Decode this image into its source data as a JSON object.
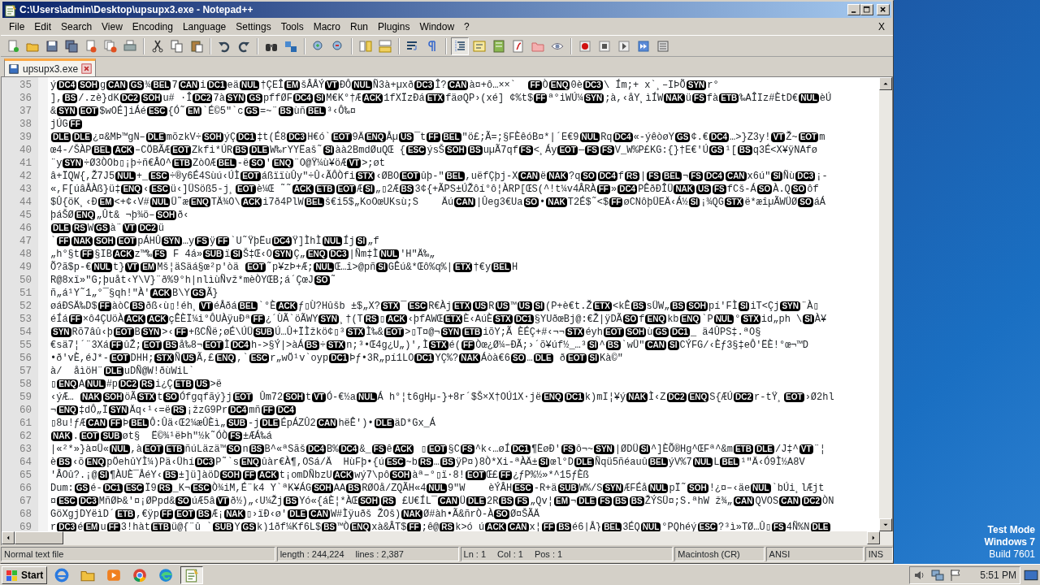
{
  "window": {
    "title": "C:\\Users\\admin\\Desktop\\upsupx3.exe - Notepad++"
  },
  "menu": [
    "File",
    "Edit",
    "Search",
    "View",
    "Encoding",
    "Language",
    "Settings",
    "Tools",
    "Macro",
    "Run",
    "Plugins",
    "Window",
    "?"
  ],
  "menu_close": "X",
  "toolbar": [
    {
      "pressed": false
    },
    {
      "pressed": false
    },
    {
      "pressed": false
    },
    {
      "pressed": false
    },
    {
      "pressed": false
    },
    {
      "pressed": false
    },
    {
      "pressed": false
    },
    {
      "pressed": false
    },
    {
      "pressed": false
    },
    {
      "pressed": false
    },
    {
      "pressed": false
    },
    {
      "pressed": false
    },
    {
      "pressed": false
    },
    {
      "pressed": false
    },
    {
      "pressed": false
    },
    {
      "pressed": false
    },
    {
      "pressed": false
    },
    {
      "pressed": false
    },
    {
      "pressed": false
    },
    {
      "pressed": false
    },
    {
      "pressed": true
    },
    {
      "pressed": false
    },
    {
      "pressed": false
    },
    {
      "pressed": false
    },
    {
      "pressed": false
    },
    {
      "pressed": false
    },
    {
      "pressed": false
    },
    {
      "pressed": false
    },
    {
      "pressed": false
    },
    {
      "pressed": false
    },
    {
      "pressed": false
    }
  ],
  "tabs": [
    {
      "label": "upsupx3.exe",
      "selected": true
    }
  ],
  "lines": [
    {
      "number": "35",
      "segments": [
        {
          "text": "ý"
        },
        {
          "ctrl": "DC4"
        },
        {
          "ctrl": "SOH"
        },
        {
          "text": "g"
        },
        {
          "ctrl": "CAN"
        },
        {
          "ctrl": "GS"
        },
        {
          "text": "¾"
        },
        {
          "ctrl": "BEL"
        },
        {
          "text": "7"
        },
        {
          "ctrl": "CAN"
        },
        {
          "text": "i"
        },
        {
          "ctrl": "DC1"
        },
        {
          "text": "eä"
        },
        {
          "ctrl": "NUL"
        },
        {
          "text": "†ÇEÎ"
        },
        {
          "ctrl": "EM"
        },
        {
          "text": "šÂÅÝ"
        },
        {
          "ctrl": "VT"
        },
        {
          "text": "ĐÔ"
        },
        {
          "ctrl": "NUL"
        },
        {
          "text": "Ñ3à+µxð"
        },
        {
          "ctrl": "DC3"
        },
        {
          "text": "Î?"
        },
        {
          "ctrl": "CAN"
        },
        {
          "text": "à¤+ô…××`  "
        },
        {
          "ctrl": "FF"
        },
        {
          "text": "Ò"
        },
        {
          "ctrl": "ENQ"
        },
        {
          "text": "0è"
        },
        {
          "ctrl": "DC3"
        },
        {
          "text": "\\ Ím;+ x`¸–IÞÕ"
        },
        {
          "ctrl": "SYN"
        },
        {
          "text": "r°"
        }
      ]
    },
    {
      "number": "36",
      "segments": [
        {
          "text": "],"
        },
        {
          "ctrl": "BS"
        },
        {
          "text": "/.zè}dK"
        },
        {
          "ctrl": "DC2"
        },
        {
          "ctrl": "SOH"
        },
        {
          "text": "u# ·Î"
        },
        {
          "ctrl": "DC2"
        },
        {
          "text": "7à"
        },
        {
          "ctrl": "SYN"
        },
        {
          "ctrl": "GS"
        },
        {
          "text": "pffØF"
        },
        {
          "ctrl": "DC4"
        },
        {
          "ctrl": "SI"
        },
        {
          "text": "M€K°†Æ"
        },
        {
          "ctrl": "ACK"
        },
        {
          "text": "1fXÏzĐá"
        },
        {
          "ctrl": "ETX"
        },
        {
          "text": "fäøQP›(xé] ¢%t$"
        },
        {
          "ctrl": "FF"
        },
        {
          "text": "ª°iWÚ¼"
        },
        {
          "ctrl": "SYN"
        },
        {
          "text": ";à,‹åY¸ìÍW"
        },
        {
          "ctrl": "NAK"
        },
        {
          "text": "ü"
        },
        {
          "ctrl": "FS"
        },
        {
          "text": "fà"
        },
        {
          "ctrl": "ETB"
        },
        {
          "text": "‰AÎIz#ÈtD€"
        },
        {
          "ctrl": "NUL"
        },
        {
          "text": "èÚ"
        }
      ]
    },
    {
      "number": "37",
      "segments": [
        {
          "text": "&"
        },
        {
          "ctrl": "SYN"
        },
        {
          "ctrl": "EOT"
        },
        {
          "text": "$wOÉ]iÁé"
        },
        {
          "ctrl": "ESC"
        },
        {
          "text": "{Ó˜"
        },
        {
          "ctrl": "EM"
        },
        {
          "text": "`É©5″`c"
        },
        {
          "ctrl": "GS"
        },
        {
          "text": "=~¨"
        },
        {
          "ctrl": "BS"
        },
        {
          "text": "ùñ"
        },
        {
          "ctrl": "BEL"
        },
        {
          "text": "³‹Ô‰¤"
        }
      ]
    },
    {
      "number": "38",
      "segments": [
        {
          "text": "jÚG"
        },
        {
          "ctrl": "FF"
        }
      ]
    },
    {
      "number": "39",
      "segments": [
        {
          "ctrl": "DLE"
        },
        {
          "ctrl": "DLE"
        },
        {
          "text": "¿¤&MÞ™gN–"
        },
        {
          "ctrl": "DLE"
        },
        {
          "text": "mõzkV÷"
        },
        {
          "ctrl": "SOH"
        },
        {
          "text": "ýÇ"
        },
        {
          "ctrl": "DC1"
        },
        {
          "text": "‡t(É8"
        },
        {
          "ctrl": "DC3"
        },
        {
          "text": "H€ó`"
        },
        {
          "ctrl": "EOT"
        },
        {
          "text": "9Ä"
        },
        {
          "ctrl": "ENQ"
        },
        {
          "text": "Åµ"
        },
        {
          "ctrl": "US"
        },
        {
          "text": "¯t"
        },
        {
          "ctrl": "FF"
        },
        {
          "ctrl": "BEL"
        },
        {
          "text": "\"ö£;Ã=;§FÈêóB¤*|´E€9"
        },
        {
          "ctrl": "NUL"
        },
        {
          "text": "Rq"
        },
        {
          "ctrl": "DC4"
        },
        {
          "text": "«-ýêòøY"
        },
        {
          "ctrl": "GS"
        },
        {
          "text": "¢.€"
        },
        {
          "ctrl": "DC4"
        },
        {
          "text": "…>}Z3y!"
        },
        {
          "ctrl": "VT"
        },
        {
          "text": "Ž~"
        },
        {
          "ctrl": "EOT"
        },
        {
          "text": "m"
        }
      ]
    },
    {
      "number": "40",
      "segments": [
        {
          "text": "œ4-/ŠÀP"
        },
        {
          "ctrl": "BEL"
        },
        {
          "ctrl": "ACK"
        },
        {
          "text": "–CÖBÃÆ"
        },
        {
          "ctrl": "EOT"
        },
        {
          "text": "Zkfi*ÚR"
        },
        {
          "ctrl": "BS"
        },
        {
          "ctrl": "DLE"
        },
        {
          "text": "W‰rYYËaš˜"
        },
        {
          "ctrl": "SI"
        },
        {
          "text": "àà2BmdØuQŒ {"
        },
        {
          "ctrl": "ESC"
        },
        {
          "text": "ýsŠ"
        },
        {
          "ctrl": "SOH"
        },
        {
          "ctrl": "BS"
        },
        {
          "text": "uµÃ7qf"
        },
        {
          "ctrl": "FS"
        },
        {
          "text": "<¸Áy"
        },
        {
          "ctrl": "EOT"
        },
        {
          "text": "—"
        },
        {
          "ctrl": "FS"
        },
        {
          "ctrl": "FS"
        },
        {
          "text": "V_W%P£KG:{}†E€'Ú"
        },
        {
          "ctrl": "GS"
        },
        {
          "text": "¹["
        },
        {
          "ctrl": "BS"
        },
        {
          "text": "q3É<X¥ÿNAfø"
        }
      ]
    },
    {
      "number": "41",
      "segments": [
        {
          "text": "¨y"
        },
        {
          "ctrl": "SYN"
        },
        {
          "text": "÷Ø3ÒOb▯¡þ÷ñ€ÂO^"
        },
        {
          "ctrl": "ETB"
        },
        {
          "text": "ZòOÆ"
        },
        {
          "ctrl": "BEL"
        },
        {
          "text": "-ë"
        },
        {
          "ctrl": "SO"
        },
        {
          "text": "'"
        },
        {
          "ctrl": "ENQ"
        },
        {
          "text": "¨O@Ÿ¼ù¥öÆ"
        },
        {
          "ctrl": "VT"
        },
        {
          "text": ">;øt"
        }
      ]
    },
    {
      "number": "42",
      "segments": [
        {
          "text": "â+ÏQW{,Ž7J5"
        },
        {
          "ctrl": "NUL"
        },
        {
          "text": "+_"
        },
        {
          "ctrl": "ESC"
        },
        {
          "text": "÷®y6É4Sùú‹ÚÌ"
        },
        {
          "ctrl": "EOT"
        },
        {
          "text": "áßïïùÛy\"÷Û‹ÃÔÒfi"
        },
        {
          "ctrl": "STX"
        },
        {
          "text": "‹ØBO"
        },
        {
          "ctrl": "EOT"
        },
        {
          "text": "ûþ-\""
        },
        {
          "ctrl": "BEL"
        },
        {
          "text": ",uëfÇþj-X"
        },
        {
          "ctrl": "CAN"
        },
        {
          "text": "ë"
        },
        {
          "ctrl": "NAK"
        },
        {
          "text": "?q"
        },
        {
          "ctrl": "SO"
        },
        {
          "ctrl": "DC4"
        },
        {
          "text": "f"
        },
        {
          "ctrl": "RS"
        },
        {
          "text": "|"
        },
        {
          "ctrl": "FS"
        },
        {
          "ctrl": "BEL"
        },
        {
          "text": "¬"
        },
        {
          "ctrl": "FS"
        },
        {
          "ctrl": "DC4"
        },
        {
          "ctrl": "CAN"
        },
        {
          "text": "x6ú\""
        },
        {
          "ctrl": "SI"
        },
        {
          "text": "Ñù"
        },
        {
          "ctrl": "DC3"
        },
        {
          "text": "¡-"
        }
      ]
    },
    {
      "number": "43",
      "segments": [
        {
          "text": "«,F[úâÅÀß}ü‡"
        },
        {
          "ctrl": "ENQ"
        },
        {
          "text": "‹"
        },
        {
          "ctrl": "ESC"
        },
        {
          "text": "ü‹]ÜSöß5-j¸"
        },
        {
          "ctrl": "EOT"
        },
        {
          "text": "è¼Œ ˜˜"
        },
        {
          "ctrl": "ACK"
        },
        {
          "ctrl": "ETB"
        },
        {
          "ctrl": "EOT"
        },
        {
          "text": "Æ"
        },
        {
          "ctrl": "SI"
        },
        {
          "text": "„▯2Æ"
        },
        {
          "ctrl": "BS"
        },
        {
          "text": "3¢{+ÃPS±ÚŽôí°ô¦ÀRP[ŒS(^!t¼v4ÂRÀ"
        },
        {
          "ctrl": "FF"
        },
        {
          "text": "»"
        },
        {
          "ctrl": "DC4"
        },
        {
          "text": "PÊðĐÎÜ"
        },
        {
          "ctrl": "NAK"
        },
        {
          "ctrl": "US"
        },
        {
          "ctrl": "FS"
        },
        {
          "text": "fCš-Á"
        },
        {
          "ctrl": "SO"
        },
        {
          "text": "À.Q"
        },
        {
          "ctrl": "SO"
        },
        {
          "text": "ôf"
        }
      ]
    },
    {
      "number": "44",
      "segments": [
        {
          "text": "$Û{öK¸‹Đ"
        },
        {
          "ctrl": "EM"
        },
        {
          "text": "<+¢‹V#"
        },
        {
          "ctrl": "NUL"
        },
        {
          "text": "Ü˜æ"
        },
        {
          "ctrl": "ENQ"
        },
        {
          "text": "TÄ¾O\\"
        },
        {
          "ctrl": "ACK"
        },
        {
          "text": "i7ð4PlW"
        },
        {
          "ctrl": "BEL"
        },
        {
          "text": "š€i5$„KoOœUKsù;S    Äú"
        },
        {
          "ctrl": "CAN"
        },
        {
          "text": "|Ûeg3€Ua"
        },
        {
          "ctrl": "SO"
        },
        {
          "text": "•"
        },
        {
          "ctrl": "NAK"
        },
        {
          "text": "T2É$˜<$"
        },
        {
          "ctrl": "FF"
        },
        {
          "text": "øCNôþÜEÄ‹Á½"
        },
        {
          "ctrl": "SI"
        },
        {
          "text": "¡¾QG"
        },
        {
          "ctrl": "STX"
        },
        {
          "text": "ë*æîµÃWÜØ"
        },
        {
          "ctrl": "SO"
        },
        {
          "text": "áÁ"
        }
      ]
    },
    {
      "number": "45",
      "segments": [
        {
          "text": "þáŠØ"
        },
        {
          "ctrl": "ENQ"
        },
        {
          "text": "„Ût& ¬þ¾ö–"
        },
        {
          "ctrl": "SOH"
        },
        {
          "text": "ð‹"
        }
      ]
    },
    {
      "number": "46",
      "segments": [
        {
          "ctrl": "DLE"
        },
        {
          "ctrl": "RS"
        },
        {
          "text": "W"
        },
        {
          "ctrl": "GS"
        },
        {
          "text": "à¨"
        },
        {
          "ctrl": "VT"
        },
        {
          "ctrl": "DC2"
        },
        {
          "text": "ü"
        }
      ]
    },
    {
      "number": "47",
      "segments": [
        {
          "text": "`"
        },
        {
          "ctrl": "FF"
        },
        {
          "ctrl": "NAK"
        },
        {
          "ctrl": "SOH"
        },
        {
          "ctrl": "EOT"
        },
        {
          "text": "pÁHÛ"
        },
        {
          "ctrl": "SYN"
        },
        {
          "text": "…y"
        },
        {
          "ctrl": "FS"
        },
        {
          "text": "ÿ"
        },
        {
          "ctrl": "FF"
        },
        {
          "text": "`U˜ŸþËu"
        },
        {
          "ctrl": "DC4"
        },
        {
          "text": "Ÿ]ÌhÌ"
        },
        {
          "ctrl": "NUL"
        },
        {
          "text": "Íj"
        },
        {
          "ctrl": "SI"
        },
        {
          "text": "„f"
        }
      ]
    },
    {
      "number": "48",
      "segments": [
        {
          "text": "„h°§t"
        },
        {
          "ctrl": "FF"
        },
        {
          "text": "§IB"
        },
        {
          "ctrl": "ACK"
        },
        {
          "text": "z™‰"
        },
        {
          "ctrl": "FS"
        },
        {
          "text": " F 4á»"
        },
        {
          "ctrl": "SUB"
        },
        {
          "text": "ï"
        },
        {
          "ctrl": "SI"
        },
        {
          "text": "Š‡Œ‹O"
        },
        {
          "ctrl": "SYN"
        },
        {
          "text": "Ç„"
        },
        {
          "ctrl": "ENQ"
        },
        {
          "ctrl": "DC3"
        },
        {
          "text": "|Ñm‡Ì"
        },
        {
          "ctrl": "NUL"
        },
        {
          "text": "'H\"Ä‰„"
        }
      ]
    },
    {
      "number": "49",
      "segments": [
        {
          "text": "Õ?ã$p-€"
        },
        {
          "ctrl": "NUL"
        },
        {
          "text": "t}"
        },
        {
          "ctrl": "VT"
        },
        {
          "ctrl": "EM"
        },
        {
          "text": "Mš¦äSäá§œ²p'òä "
        },
        {
          "ctrl": "EOT"
        },
        {
          "text": "˜p¥zÞ+Æ;"
        },
        {
          "ctrl": "NUL"
        },
        {
          "text": "Œ…î>@pñ"
        },
        {
          "ctrl": "SI"
        },
        {
          "text": "GÊú&*Œô%q%|"
        },
        {
          "ctrl": "ETX"
        },
        {
          "text": "†€y"
        },
        {
          "ctrl": "BEL"
        },
        {
          "text": "H"
        }
      ]
    },
    {
      "number": "50",
      "segments": [
        {
          "text": "R@8xï»″G;þuåt‹Y\\V}¨ð%9°h|nlìùÑvž*mèÒYŒB;á´ÇœJ"
        },
        {
          "ctrl": "SO"
        },
        {
          "text": "˜"
        }
      ]
    },
    {
      "number": "51",
      "segments": [
        {
          "text": "ñ„á¹Y˜1„°¯§qh!″À'"
        },
        {
          "ctrl": "ACK"
        },
        {
          "text": "B\\Y"
        },
        {
          "ctrl": "GS"
        },
        {
          "text": "Ã}"
        }
      ]
    },
    {
      "number": "52",
      "segments": [
        {
          "text": "øáĐSÄ‰D$"
        },
        {
          "ctrl": "FF"
        },
        {
          "text": "àòC"
        },
        {
          "ctrl": "BS"
        },
        {
          "text": "ðß‹ù▯!éh¸"
        },
        {
          "ctrl": "VT"
        },
        {
          "text": "éÅðá"
        },
        {
          "ctrl": "BEL"
        },
        {
          "text": "`°È"
        },
        {
          "ctrl": "ACK"
        },
        {
          "text": "ƒ▯Ù?Hûšb ±$„X?"
        },
        {
          "ctrl": "STX"
        },
        {
          "text": "¯"
        },
        {
          "ctrl": "ESC"
        },
        {
          "text": "R€Àj"
        },
        {
          "ctrl": "ETX"
        },
        {
          "ctrl": "US"
        },
        {
          "text": "R"
        },
        {
          "ctrl": "US"
        },
        {
          "text": "™"
        },
        {
          "ctrl": "US"
        },
        {
          "ctrl": "SI"
        },
        {
          "text": "(P+è€t.Ž"
        },
        {
          "ctrl": "ETX"
        },
        {
          "text": "<kÊ"
        },
        {
          "ctrl": "BS"
        },
        {
          "text": "sÜW„"
        },
        {
          "ctrl": "BS"
        },
        {
          "ctrl": "SOH"
        },
        {
          "text": "pí'FÌ"
        },
        {
          "ctrl": "SI"
        },
        {
          "text": "iT<Çj"
        },
        {
          "ctrl": "SYN"
        },
        {
          "text": "¨À▯"
        }
      ]
    },
    {
      "number": "53",
      "segments": [
        {
          "text": "éÍá"
        },
        {
          "ctrl": "FF"
        },
        {
          "text": "×ô4ÇUöÀ"
        },
        {
          "ctrl": "ACK"
        },
        {
          "ctrl": "ACK"
        },
        {
          "text": "çÊÈÏ¼i°ÔUÀÿuÐª"
        },
        {
          "ctrl": "FF"
        },
        {
          "text": "¿´ÙÃ`öÃWY"
        },
        {
          "ctrl": "SYN"
        },
        {
          "text": "¸†(T"
        },
        {
          "ctrl": "RS"
        },
        {
          "text": "▯"
        },
        {
          "ctrl": "ACK"
        },
        {
          "text": "‹þfAWŒ"
        },
        {
          "ctrl": "ETX"
        },
        {
          "text": "È‹AúÈ"
        },
        {
          "ctrl": "STX"
        },
        {
          "ctrl": "DC1"
        },
        {
          "text": "§YUðœBj@:€Ž|ÿDÃ"
        },
        {
          "ctrl": "SO"
        },
        {
          "text": "f"
        },
        {
          "ctrl": "ENQ"
        },
        {
          "text": "kb"
        },
        {
          "ctrl": "ENQ"
        },
        {
          "text": "`P"
        },
        {
          "ctrl": "NUL"
        },
        {
          "text": "°"
        },
        {
          "ctrl": "STX"
        },
        {
          "text": "id„ph \\"
        },
        {
          "ctrl": "SI"
        },
        {
          "text": "À¥"
        }
      ]
    },
    {
      "number": "54",
      "segments": [
        {
          "ctrl": "SYN"
        },
        {
          "text": "Rõ7âû‹þ"
        },
        {
          "ctrl": "EOT"
        },
        {
          "text": "B"
        },
        {
          "ctrl": "SYN"
        },
        {
          "text": ">‹"
        },
        {
          "ctrl": "FF"
        },
        {
          "text": "+ßCÑë;øÉ\\ÚÜ"
        },
        {
          "ctrl": "SUB"
        },
        {
          "text": "Ú…Û+ÏÌžkö¢▯³"
        },
        {
          "ctrl": "STX"
        },
        {
          "text": "Ì‰&"
        },
        {
          "ctrl": "EOT"
        },
        {
          "text": ">▯T¤@¬"
        },
        {
          "ctrl": "SYN"
        },
        {
          "ctrl": "ETB"
        },
        {
          "text": "iõY;Ã ÈÉÇ+#‹¬¬"
        },
        {
          "ctrl": "STX"
        },
        {
          "text": "éyh"
        },
        {
          "ctrl": "EOT"
        },
        {
          "ctrl": "SOH"
        },
        {
          "text": "ù"
        },
        {
          "ctrl": "GS"
        },
        {
          "ctrl": "DC1"
        },
        {
          "text": "_ ä4ÛPS‡.ªO§"
        }
      ]
    },
    {
      "number": "55",
      "segments": [
        {
          "text": "€sä7¦´¨3Xá"
        },
        {
          "ctrl": "FF"
        },
        {
          "text": "ûŽ;"
        },
        {
          "ctrl": "EOT"
        },
        {
          "ctrl": "BS"
        },
        {
          "text": "å‰8¬"
        },
        {
          "ctrl": "EOT"
        },
        {
          "text": "Ì"
        },
        {
          "ctrl": "DC4"
        },
        {
          "text": "h->§Ý|>àÁ"
        },
        {
          "ctrl": "BS"
        },
        {
          "text": "÷"
        },
        {
          "ctrl": "STX"
        },
        {
          "text": "n;³•Œ4g¿U„)',Ì"
        },
        {
          "ctrl": "STX"
        },
        {
          "text": "é("
        },
        {
          "ctrl": "FF"
        },
        {
          "text": "Òœ¿Ø¼–ĐÃ;›´õ¥úf½_…³"
        },
        {
          "ctrl": "SI"
        },
        {
          "text": "^"
        },
        {
          "ctrl": "BS"
        },
        {
          "text": "`wÜ″"
        },
        {
          "ctrl": "CAN"
        },
        {
          "ctrl": "SI"
        },
        {
          "text": "CÝFG/‹Èƒ3§‡eÔ'ËÈ!°œ¬™D"
        }
      ]
    },
    {
      "number": "56",
      "segments": [
        {
          "text": "•ð'vÈ,éJ*-"
        },
        {
          "ctrl": "EOT"
        },
        {
          "text": "DHH;"
        },
        {
          "ctrl": "STX"
        },
        {
          "text": "Ñ"
        },
        {
          "ctrl": "US"
        },
        {
          "text": "Ã,£"
        },
        {
          "ctrl": "ENQ"
        },
        {
          "text": ",`"
        },
        {
          "ctrl": "ESC"
        },
        {
          "text": "r„wÖ¹v`oyp"
        },
        {
          "ctrl": "DC1"
        },
        {
          "text": "Þƒ•3R„pí1LO"
        },
        {
          "ctrl": "DC1"
        },
        {
          "text": "YÇ%?"
        },
        {
          "ctrl": "NAK"
        },
        {
          "text": "Áòà€6"
        },
        {
          "ctrl": "SO"
        },
        {
          "text": "…"
        },
        {
          "ctrl": "DLE"
        },
        {
          "text": " ð"
        },
        {
          "ctrl": "EOT"
        },
        {
          "ctrl": "SI"
        },
        {
          "text": "Kà©″"
        }
      ]
    },
    {
      "number": "57",
      "segments": [
        {
          "text": "à/  åìöH¨"
        },
        {
          "ctrl": "DLE"
        },
        {
          "text": "uDÑ@W!ðùWiL`"
        }
      ]
    },
    {
      "number": "58",
      "segments": [
        {
          "text": "▯"
        },
        {
          "ctrl": "ENQ"
        },
        {
          "text": "A"
        },
        {
          "ctrl": "NUL"
        },
        {
          "text": "#p"
        },
        {
          "ctrl": "DC2"
        },
        {
          "ctrl": "RS"
        },
        {
          "text": "i¿Ç"
        },
        {
          "ctrl": "ETB"
        },
        {
          "ctrl": "US"
        },
        {
          "text": ">ë"
        }
      ]
    },
    {
      "number": "59",
      "segments": [
        {
          "text": "‹ýÆ… "
        },
        {
          "ctrl": "NAK"
        },
        {
          "ctrl": "SOH"
        },
        {
          "text": "öÃ"
        },
        {
          "ctrl": "STX"
        },
        {
          "text": "t"
        },
        {
          "ctrl": "SO"
        },
        {
          "text": "Ófgqfãý}j"
        },
        {
          "ctrl": "EOT"
        },
        {
          "text": " Ûm72"
        },
        {
          "ctrl": "SOH"
        },
        {
          "text": "t"
        },
        {
          "ctrl": "VT"
        },
        {
          "text": "Ó-€½a"
        },
        {
          "ctrl": "NUL"
        },
        {
          "text": "Á h°¦t6gHµ-}+8r´$Š×X†OÚ1X·jë"
        },
        {
          "ctrl": "ENQ"
        },
        {
          "ctrl": "DC1"
        },
        {
          "text": "k)mI¦¥ý"
        },
        {
          "ctrl": "NAK"
        },
        {
          "text": "Ì‹Z"
        },
        {
          "ctrl": "DC2"
        },
        {
          "ctrl": "ENQ"
        },
        {
          "text": "S{ÆÚ"
        },
        {
          "ctrl": "DC2"
        },
        {
          "text": "r-tŸ¸"
        },
        {
          "ctrl": "EOT"
        },
        {
          "text": "›Ø2hl"
        }
      ]
    },
    {
      "number": "60",
      "segments": [
        {
          "text": "¬"
        },
        {
          "ctrl": "ENQ"
        },
        {
          "text": "‡dÔ„Ï"
        },
        {
          "ctrl": "SYN"
        },
        {
          "text": "Äq‹¹‹=ë"
        },
        {
          "ctrl": "RS"
        },
        {
          "text": "¡žzG9Pr"
        },
        {
          "ctrl": "DC4"
        },
        {
          "text": "mñ"
        },
        {
          "ctrl": "FF"
        },
        {
          "ctrl": "DC4"
        }
      ]
    },
    {
      "number": "61",
      "segments": [
        {
          "text": "▯8u!ƒÆ"
        },
        {
          "ctrl": "CAN"
        },
        {
          "ctrl": "FF"
        },
        {
          "text": "Þ"
        },
        {
          "ctrl": "BEL"
        },
        {
          "text": "Ô:Ûä‹Œ2¼æÛÈì„"
        },
        {
          "ctrl": "SUB"
        },
        {
          "text": "-j"
        },
        {
          "ctrl": "DLE"
        },
        {
          "text": "ÉpÁZÛ2"
        },
        {
          "ctrl": "CAN"
        },
        {
          "text": "hëÊ')•"
        },
        {
          "ctrl": "DLE"
        },
        {
          "text": "äD*Gx_Á"
        }
      ]
    },
    {
      "number": "62",
      "segments": [
        {
          "ctrl": "NAK"
        },
        {
          "text": "."
        },
        {
          "ctrl": "EOT"
        },
        {
          "ctrl": "SUB"
        },
        {
          "text": "øt§  Ë©¾¹ëÞh″½k˜ÓÒ"
        },
        {
          "ctrl": "FS"
        },
        {
          "text": "±ÆÁ‰á"
        }
      ]
    },
    {
      "number": "63",
      "segments": [
        {
          "text": "|«²*»}à¤Ü«"
        },
        {
          "ctrl": "NUL"
        },
        {
          "text": ",à"
        },
        {
          "ctrl": "EOT"
        },
        {
          "ctrl": "ETB"
        },
        {
          "text": "ñúLäzä™"
        },
        {
          "ctrl": "SO"
        },
        {
          "text": "n"
        },
        {
          "ctrl": "BS"
        },
        {
          "text": "B^«ªSãš"
        },
        {
          "ctrl": "DC4"
        },
        {
          "text": "B%"
        },
        {
          "ctrl": "DC4"
        },
        {
          "text": "&_"
        },
        {
          "ctrl": "FS"
        },
        {
          "text": "ê"
        },
        {
          "ctrl": "ACK"
        },
        {
          "text": " ▯"
        },
        {
          "ctrl": "EOT"
        },
        {
          "text": "§C"
        },
        {
          "ctrl": "FS"
        },
        {
          "text": "^k‹…øÍ"
        },
        {
          "ctrl": "DC1"
        },
        {
          "text": "¶ËøÐ'"
        },
        {
          "ctrl": "FS"
        },
        {
          "text": "ô¬~"
        },
        {
          "ctrl": "SYN"
        },
        {
          "text": "|ØDÜ"
        },
        {
          "ctrl": "SI"
        },
        {
          "text": "^]ÈÕ®Hg^ŒFª^&m"
        },
        {
          "ctrl": "ETB"
        },
        {
          "ctrl": "DLE"
        },
        {
          "text": "/J‡^"
        },
        {
          "ctrl": "VT"
        },
        {
          "text": "¨¦"
        }
      ]
    },
    {
      "number": "64",
      "segments": [
        {
          "text": "è"
        },
        {
          "ctrl": "BS"
        },
        {
          "text": "‹õ"
        },
        {
          "ctrl": "ENQ"
        },
        {
          "text": "pÖehûYÌ¼)Pä‹Ühí"
        },
        {
          "ctrl": "DC3"
        },
        {
          "text": "P˜`s"
        },
        {
          "ctrl": "ENQ"
        },
        {
          "text": "ûàr€À¶,OSá/Ä  HùFþ•{ú"
        },
        {
          "ctrl": "ESC"
        },
        {
          "text": "~b"
        },
        {
          "ctrl": "RS"
        },
        {
          "text": "…"
        },
        {
          "ctrl": "BS"
        },
        {
          "text": "ÿP¤)8Ò*Xi-ªÀÄ±"
        },
        {
          "ctrl": "SI"
        },
        {
          "text": "œl°D"
        },
        {
          "ctrl": "DLE"
        },
        {
          "text": "Ñqü5ñéauû"
        },
        {
          "ctrl": "BEL"
        },
        {
          "text": "ýV%7"
        },
        {
          "ctrl": "NUL"
        },
        {
          "text": "L"
        },
        {
          "ctrl": "BEL"
        },
        {
          "text": "¹″Ä‹Ó9Ì½A8V"
        }
      ]
    },
    {
      "number": "65",
      "segments": [
        {
          "text": "'ÂOû?.¡@"
        },
        {
          "ctrl": "SI"
        },
        {
          "text": "¶ÀUÈ¯ÅéY‹"
        },
        {
          "ctrl": "BS"
        },
        {
          "text": "±]ü]àöD"
        },
        {
          "ctrl": "SOH"
        },
        {
          "ctrl": "FF"
        },
        {
          "ctrl": "ACK"
        },
        {
          "text": "t¡omDÑbzU"
        },
        {
          "ctrl": "ACK"
        },
        {
          "text": "wý7\\pô"
        },
        {
          "ctrl": "SOH"
        },
        {
          "text": "àª–°▯ï·8!"
        },
        {
          "ctrl": "EOT"
        },
        {
          "text": "Œ£"
        },
        {
          "ctrl": "FF"
        },
        {
          "text": "¿ƒP%½»*^15ƒÈß"
        }
      ]
    },
    {
      "number": "66",
      "segments": [
        {
          "text": "Dum:"
        },
        {
          "ctrl": "GS"
        },
        {
          "text": "é-"
        },
        {
          "ctrl": "DC1"
        },
        {
          "ctrl": "ESC"
        },
        {
          "text": "Ï9"
        },
        {
          "ctrl": "RS"
        },
        {
          "text": "_K¬"
        },
        {
          "ctrl": "ESC"
        },
        {
          "text": "Ò¾iM,É¨k4 Y`ªK¥ÁG"
        },
        {
          "ctrl": "SOH"
        },
        {
          "text": "AA"
        },
        {
          "ctrl": "BS"
        },
        {
          "text": "RØOå/ZQÃH«4"
        },
        {
          "ctrl": "NUL"
        },
        {
          "text": "9\"W    èÝÂH"
        },
        {
          "ctrl": "ESC"
        },
        {
          "text": "-R+ä"
        },
        {
          "ctrl": "SUB"
        },
        {
          "text": "W%/S"
        },
        {
          "ctrl": "SYN"
        },
        {
          "text": "ÆFÉå"
        },
        {
          "ctrl": "NUL"
        },
        {
          "text": "pÏ˜"
        },
        {
          "ctrl": "SOH"
        },
        {
          "text": "!¿¤–‹äe"
        },
        {
          "ctrl": "NUL"
        },
        {
          "text": "`bÚi¸lÆjt"
        }
      ]
    },
    {
      "number": "67",
      "segments": [
        {
          "text": "¤"
        },
        {
          "ctrl": "ESC"
        },
        {
          "ctrl": "DC3"
        },
        {
          "text": "MñØÞ&'¤¡ØPpd&"
        },
        {
          "ctrl": "SO"
        },
        {
          "text": "úÆ5â"
        },
        {
          "ctrl": "VT"
        },
        {
          "text": "ð½)„‹U¼Žj"
        },
        {
          "ctrl": "BS"
        },
        {
          "text": "Yó«{áÈ¦*ÀŒ"
        },
        {
          "ctrl": "SOH"
        },
        {
          "ctrl": "RS"
        },
        {
          "text": " £U€ÍL¯"
        },
        {
          "ctrl": "CAN"
        },
        {
          "text": "Ü"
        },
        {
          "ctrl": "DLE"
        },
        {
          "text": "2R"
        },
        {
          "ctrl": "BS"
        },
        {
          "ctrl": "FS"
        },
        {
          "text": "„Qv¦"
        },
        {
          "ctrl": "EM"
        },
        {
          "text": "¬"
        },
        {
          "ctrl": "DLE"
        },
        {
          "ctrl": "FS"
        },
        {
          "ctrl": "BS"
        },
        {
          "ctrl": "BS"
        },
        {
          "text": "ŽÝSÜ¤;S.ªhW ž¾„"
        },
        {
          "ctrl": "CAN"
        },
        {
          "text": "QVOS"
        },
        {
          "ctrl": "CAN"
        },
        {
          "ctrl": "DC2"
        },
        {
          "text": "ÒN"
        }
      ]
    },
    {
      "number": "68",
      "segments": [
        {
          "text": "GöXgjDYëìD´"
        },
        {
          "ctrl": "ETB"
        },
        {
          "text": ",€ÿp"
        },
        {
          "ctrl": "FF"
        },
        {
          "ctrl": "EOT"
        },
        {
          "ctrl": "BS"
        },
        {
          "text": "Æ¡"
        },
        {
          "ctrl": "NAK"
        },
        {
          "text": "▯›ïĐ‹ø'"
        },
        {
          "ctrl": "DLE"
        },
        {
          "ctrl": "CAN"
        },
        {
          "text": "W#Ìÿuðš ŽOš)"
        },
        {
          "ctrl": "NAK"
        },
        {
          "text": "Ø#àh•Ã&ñrÒ-À"
        },
        {
          "ctrl": "SO"
        },
        {
          "text": "Ø¤ŠÃÄ"
        }
      ]
    },
    {
      "number": "69",
      "segments": [
        {
          "text": "r"
        },
        {
          "ctrl": "DC3"
        },
        {
          "text": "é"
        },
        {
          "ctrl": "EM"
        },
        {
          "text": "u"
        },
        {
          "ctrl": "FF"
        },
        {
          "text": "3!hàt"
        },
        {
          "ctrl": "ETB"
        },
        {
          "text": "ü@{¨û `"
        },
        {
          "ctrl": "SUB"
        },
        {
          "text": "Y"
        },
        {
          "ctrl": "GS"
        },
        {
          "text": "k)1ðf¼Kf6L$"
        },
        {
          "ctrl": "BS"
        },
        {
          "text": "™Ò"
        },
        {
          "ctrl": "ENQ"
        },
        {
          "text": "xà&ÂT$"
        },
        {
          "ctrl": "FF"
        },
        {
          "text": ";ê@"
        },
        {
          "ctrl": "RS"
        },
        {
          "text": "k>ó ú"
        },
        {
          "ctrl": "ACK"
        },
        {
          "ctrl": "CAN"
        },
        {
          "text": "x¦"
        },
        {
          "ctrl": "FF"
        },
        {
          "ctrl": "BS"
        },
        {
          "text": "é6|Å}"
        },
        {
          "ctrl": "BEL"
        },
        {
          "text": "3ÉQ"
        },
        {
          "ctrl": "NUL"
        },
        {
          "text": "°PQhéý"
        },
        {
          "ctrl": "ESC"
        },
        {
          "text": "?³ì»TØ…Û▯"
        },
        {
          "ctrl": "FS"
        },
        {
          "text": "4Ñ%N"
        },
        {
          "ctrl": "DLE"
        }
      ]
    }
  ],
  "status_bar": {
    "file_type": "Normal text file",
    "length": "length : 244,224",
    "lines": "lines : 2,387",
    "ln": "Ln : 1",
    "col": "Col : 1",
    "pos": "Pos : 1",
    "eol": "Macintosh (CR)",
    "encoding": "ANSI",
    "mode": "INS"
  },
  "desktop": {
    "watermark_lines": [
      "Test Mode",
      "Windows 7",
      "Build 7601"
    ]
  },
  "taskbar": {
    "start": "Start",
    "apps": [
      {
        "active": false
      },
      {
        "active": false
      },
      {
        "active": false
      },
      {
        "active": false
      },
      {
        "active": false
      },
      {
        "active": true
      }
    ],
    "clock": "5:51 PM"
  }
}
